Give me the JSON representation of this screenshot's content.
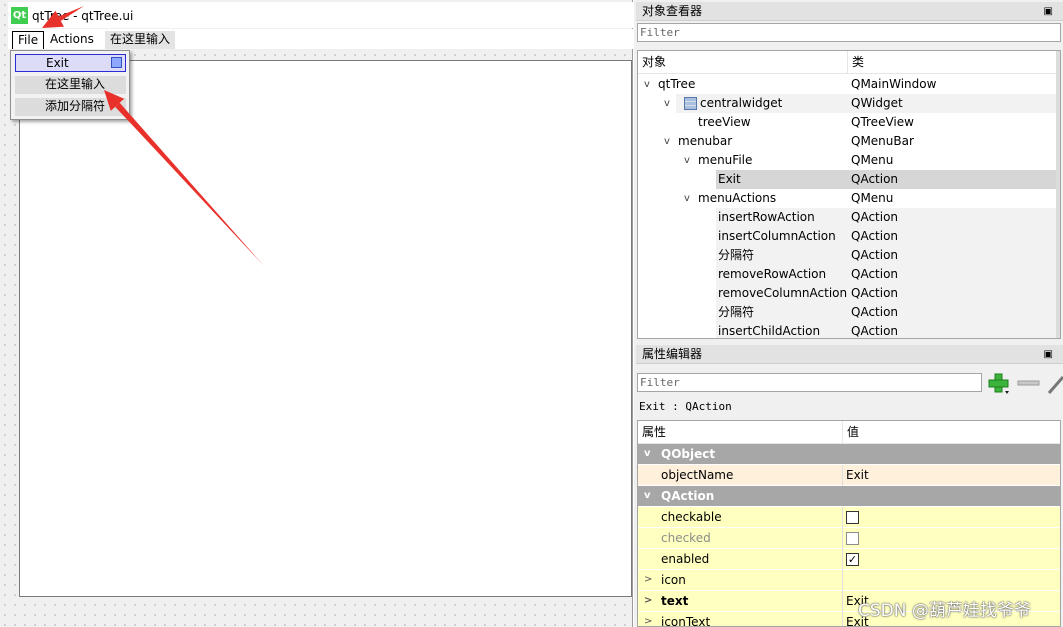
{
  "form": {
    "logo_text": "Qt",
    "window_title": "qtTree - qtTree.ui",
    "menubar": [
      "File",
      "Actions",
      "在这里输入"
    ],
    "file_menu": [
      "Exit",
      "在这里输入",
      "添加分隔符"
    ],
    "arrow_color": "#e8312a"
  },
  "object_inspector": {
    "title": "对象查看器",
    "float_icon": "float-icon",
    "filter_placeholder": "Filter",
    "col_object": "对象",
    "col_class": "类",
    "rows": [
      {
        "name": "qtTree",
        "class": "QMainWindow"
      },
      {
        "name": "centralwidget",
        "class": "QWidget"
      },
      {
        "name": "treeView",
        "class": "QTreeView"
      },
      {
        "name": "menubar",
        "class": "QMenuBar"
      },
      {
        "name": "menuFile",
        "class": "QMenu"
      },
      {
        "name": "Exit",
        "class": "QAction"
      },
      {
        "name": "menuActions",
        "class": "QMenu"
      },
      {
        "name": "insertRowAction",
        "class": "QAction"
      },
      {
        "name": "insertColumnAction",
        "class": "QAction"
      },
      {
        "name": "分隔符",
        "class": "QAction"
      },
      {
        "name": "removeRowAction",
        "class": "QAction"
      },
      {
        "name": "removeColumnAction",
        "class": "QAction"
      },
      {
        "name": "分隔符",
        "class": "QAction"
      },
      {
        "name": "insertChildAction",
        "class": "QAction"
      }
    ]
  },
  "property_editor": {
    "title": "属性编辑器",
    "filter_placeholder": "Filter",
    "context": "Exit : QAction",
    "col_property": "属性",
    "col_value": "值",
    "groups": [
      "QObject",
      "QAction"
    ],
    "rows": [
      {
        "name": "objectName",
        "value": "Exit"
      },
      {
        "name": "checkable",
        "checked": false
      },
      {
        "name": "checked",
        "checked": false
      },
      {
        "name": "enabled",
        "checked": true
      },
      {
        "name": "icon",
        "value": ""
      },
      {
        "name": "text",
        "value": "Exit"
      },
      {
        "name": "iconText",
        "value": "Exit"
      }
    ]
  },
  "watermark": "CSDN @葫芦娃找爷爷"
}
